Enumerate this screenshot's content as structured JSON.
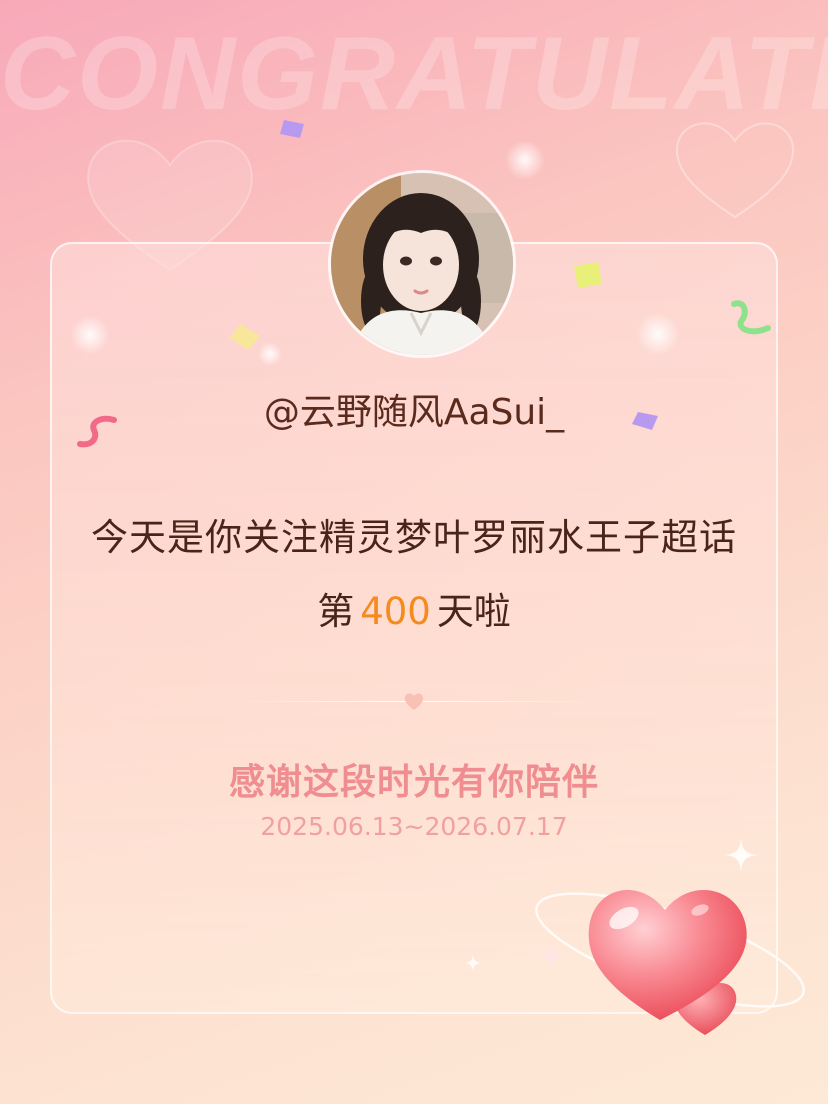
{
  "background": {
    "headline_word": "CONGRATULATE",
    "colors": {
      "gradient_start": "#f8a9b9",
      "gradient_end": "#fde9d6"
    }
  },
  "profile": {
    "avatar": "user-avatar-photo",
    "username": "@云野随风AaSui_"
  },
  "message": {
    "line1": "今天是你关注精灵梦叶罗丽水王子超话",
    "line2_prefix": "第",
    "days": "400",
    "line2_suffix": "天啦"
  },
  "footer": {
    "thanks": "感谢这段时光有你陪伴",
    "date_range": "2025.06.13~2026.07.17"
  },
  "decorations": {
    "icons": [
      "confetti-icon",
      "heart-icon",
      "sparkle-icon",
      "ribbon-icon"
    ],
    "colors": {
      "accent_orange": "#f58a1f",
      "thanks_pink": "#ef8d90",
      "heart_red": "#f2545b"
    }
  }
}
